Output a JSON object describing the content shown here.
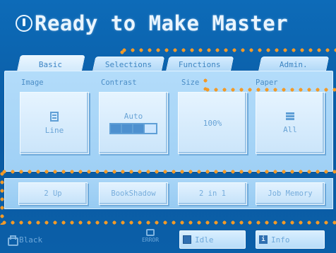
{
  "title": "Ready to Make Master",
  "tabs": [
    {
      "label": "Basic",
      "active": true
    },
    {
      "label": "Selections",
      "active": false
    },
    {
      "label": "Functions",
      "active": false
    },
    {
      "label": "Admin.",
      "active": false
    }
  ],
  "sections": {
    "image": "Image",
    "contrast": "Contrast",
    "size": "Size",
    "paper": "Paper"
  },
  "tiles": {
    "image_value": "Line",
    "contrast_value": "Auto",
    "contrast_level": 3,
    "contrast_segments": 4,
    "size_value": "100%",
    "paper_value": "All"
  },
  "quick_buttons": [
    "2 Up",
    "BookShadow",
    "2 in 1",
    "Job Memory"
  ],
  "status": {
    "ink": "Black",
    "error": "ERROR",
    "idle": "Idle",
    "info": "Info"
  },
  "colors": {
    "background": "#0b5fa8",
    "panel": "#a8d5f7",
    "annotation": "#f29a28"
  },
  "icons": [
    "status-icon",
    "document-icon",
    "paper-stack-icon",
    "ink-drum-icon",
    "error-icon",
    "idle-square-icon",
    "info-icon"
  ]
}
